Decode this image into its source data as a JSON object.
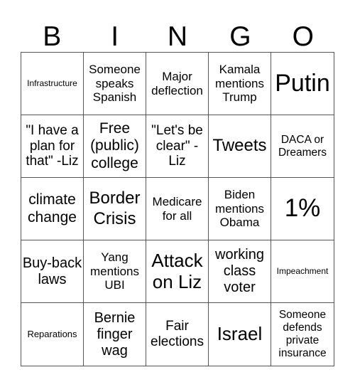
{
  "header": {
    "letters": [
      "B",
      "I",
      "N",
      "G",
      "O"
    ]
  },
  "cells": [
    "Infrastructure",
    "Someone speaks Spanish",
    "Major deflection",
    "Kamala mentions Trump",
    "Putin",
    "\"I have a plan for that\" -Liz",
    "Free (public) college",
    "\"Let's be clear\" - Liz",
    "Tweets",
    "DACA or Dreamers",
    "climate change",
    "Border Crisis",
    "Medicare for all",
    "Biden mentions Obama",
    "1%",
    "Buy-back laws",
    "Yang mentions UBI",
    "Attack on Liz",
    "working class voter",
    "Impeachment",
    "Reparations",
    "Bernie finger wag",
    "Fair elections",
    "Israel",
    "Someone defends private insurance"
  ]
}
